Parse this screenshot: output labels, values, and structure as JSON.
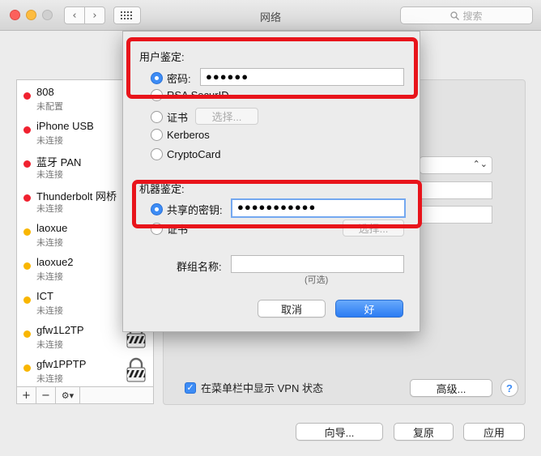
{
  "window": {
    "title": "网络",
    "search_placeholder": "搜索"
  },
  "services": [
    {
      "name": "808",
      "status": "未配置",
      "color": "red",
      "lock": false
    },
    {
      "name": "iPhone USB",
      "status": "未连接",
      "color": "red",
      "lock": false
    },
    {
      "name": "蓝牙 PAN",
      "status": "未连接",
      "color": "red",
      "lock": false
    },
    {
      "name": "Thunderbolt 网桥",
      "status": "未连接",
      "color": "red",
      "lock": false
    },
    {
      "name": "laoxue",
      "status": "未连接",
      "color": "yellow",
      "lock": false
    },
    {
      "name": "laoxue2",
      "status": "未连接",
      "color": "yellow",
      "lock": false
    },
    {
      "name": "ICT",
      "status": "未连接",
      "color": "yellow",
      "lock": false
    },
    {
      "name": "gfw1L2TP",
      "status": "未连接",
      "color": "yellow",
      "lock": true
    },
    {
      "name": "gfw1PPTP",
      "status": "未连接",
      "color": "yellow",
      "lock": true
    }
  ],
  "list_toolbar": {
    "add": "+",
    "remove": "−",
    "gear": "⚙▾"
  },
  "sheet": {
    "user_auth_label": "用户鉴定:",
    "user_auth_options": [
      {
        "label": "密码:",
        "selected": true
      },
      {
        "label": "RSA SecurID",
        "selected": false
      },
      {
        "label": "证书",
        "selected": false
      },
      {
        "label": "Kerberos",
        "selected": false
      },
      {
        "label": "CryptoCard",
        "selected": false
      }
    ],
    "password_value": "●●●●●●",
    "choose_label": "选择...",
    "machine_auth_label": "机器鉴定:",
    "machine_auth_options": [
      {
        "label": "共享的密钥:",
        "selected": true
      },
      {
        "label": "证书",
        "selected": false
      }
    ],
    "shared_secret_value": "●●●●●●●●●●●",
    "choose_label_2": "选择...",
    "group_name_label": "群组名称:",
    "group_name_value": "",
    "optional_hint": "(可选)",
    "cancel_label": "取消",
    "ok_label": "好"
  },
  "panel": {
    "show_vpn_status_label": "在菜单栏中显示 VPN 状态",
    "show_vpn_status_checked": true,
    "advanced_label": "高级...",
    "help_label": "?"
  },
  "bottom": {
    "assist_label": "向导...",
    "revert_label": "复原",
    "apply_label": "应用"
  },
  "colors": {
    "accent": "#3d8cf5",
    "annotation": "#e8141b",
    "status_red": "#f0212f",
    "status_yellow": "#f9b600"
  }
}
